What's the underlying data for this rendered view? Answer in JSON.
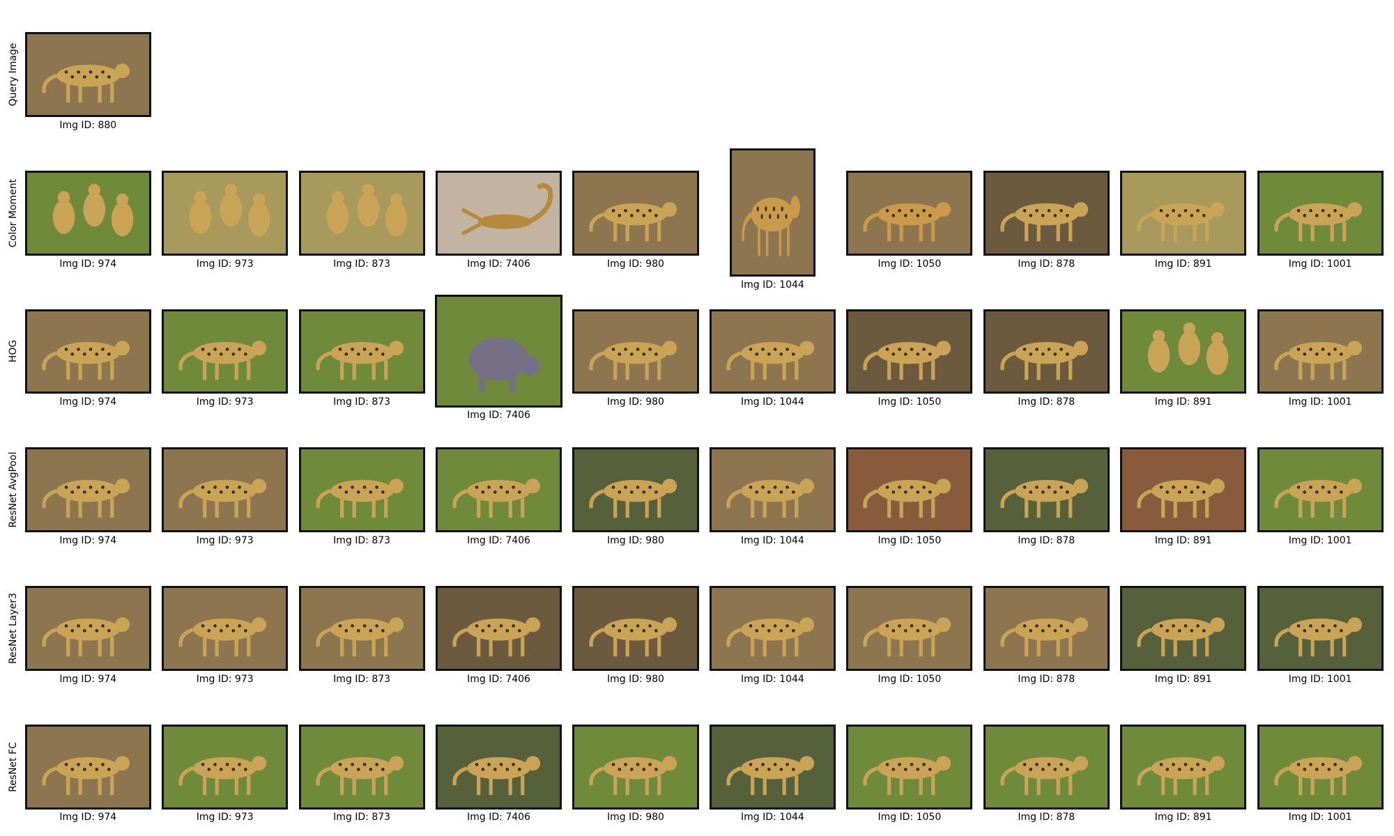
{
  "rows": [
    {
      "label": "Query Image",
      "tiles": [
        {
          "caption": "Img ID: 880",
          "subject": "cheetah",
          "scene": "dirt"
        }
      ]
    },
    {
      "label": "Color Moment",
      "tiles": [
        {
          "caption": "Img ID: 974",
          "subject": "cheetah group",
          "scene": "grass"
        },
        {
          "caption": "Img ID: 973",
          "subject": "cheetah group",
          "scene": "dry grass"
        },
        {
          "caption": "Img ID: 873",
          "subject": "cheetah group",
          "scene": "dry grass"
        },
        {
          "caption": "Img ID: 7406",
          "subject": "scorpion",
          "scene": "gravel"
        },
        {
          "caption": "Img ID: 980",
          "subject": "cheetah",
          "scene": "dirt"
        },
        {
          "caption": "Img ID: 1044",
          "subject": "leopard",
          "scene": "dirt"
        },
        {
          "caption": "Img ID: 1050",
          "subject": "leopard",
          "scene": "dirt"
        },
        {
          "caption": "Img ID: 878",
          "subject": "cheetah",
          "scene": "dark dirt"
        },
        {
          "caption": "Img ID: 891",
          "subject": "cheetah",
          "scene": "dry grass"
        },
        {
          "caption": "Img ID: 1001",
          "subject": "cheetah",
          "scene": "grass"
        }
      ]
    },
    {
      "label": "HOG",
      "tiles": [
        {
          "caption": "Img ID: 974",
          "subject": "cheetah",
          "scene": "dirt"
        },
        {
          "caption": "Img ID: 973",
          "subject": "cheetah",
          "scene": "grass"
        },
        {
          "caption": "Img ID: 873",
          "subject": "cheetah",
          "scene": "grass"
        },
        {
          "caption": "Img ID: 7406",
          "subject": "rhinoceros",
          "scene": "grass"
        },
        {
          "caption": "Img ID: 980",
          "subject": "cheetah",
          "scene": "dirt"
        },
        {
          "caption": "Img ID: 1044",
          "subject": "cheetah",
          "scene": "dirt"
        },
        {
          "caption": "Img ID: 1050",
          "subject": "cheetah",
          "scene": "dark dirt"
        },
        {
          "caption": "Img ID: 878",
          "subject": "cheetah",
          "scene": "dark dirt"
        },
        {
          "caption": "Img ID: 891",
          "subject": "cheetah group",
          "scene": "grass"
        },
        {
          "caption": "Img ID: 1001",
          "subject": "cheetah",
          "scene": "dirt"
        }
      ]
    },
    {
      "label": "ResNet AvgPool",
      "tiles": [
        {
          "caption": "Img ID: 974",
          "subject": "cheetah",
          "scene": "dirt"
        },
        {
          "caption": "Img ID: 973",
          "subject": "cheetah",
          "scene": "dirt"
        },
        {
          "caption": "Img ID: 873",
          "subject": "cheetah",
          "scene": "grass"
        },
        {
          "caption": "Img ID: 7406",
          "subject": "cheetah",
          "scene": "grass"
        },
        {
          "caption": "Img ID: 980",
          "subject": "cheetah",
          "scene": "dark grass"
        },
        {
          "caption": "Img ID: 1044",
          "subject": "cheetah",
          "scene": "dirt"
        },
        {
          "caption": "Img ID: 1050",
          "subject": "cheetah",
          "scene": "red grass"
        },
        {
          "caption": "Img ID: 878",
          "subject": "cheetah",
          "scene": "dark grass"
        },
        {
          "caption": "Img ID: 891",
          "subject": "cheetah",
          "scene": "red grass"
        },
        {
          "caption": "Img ID: 1001",
          "subject": "cheetah",
          "scene": "grass"
        }
      ]
    },
    {
      "label": "ResNet Layer3",
      "tiles": [
        {
          "caption": "Img ID: 974",
          "subject": "cheetah",
          "scene": "dirt"
        },
        {
          "caption": "Img ID: 973",
          "subject": "cheetah",
          "scene": "dirt"
        },
        {
          "caption": "Img ID: 873",
          "subject": "cheetah",
          "scene": "dirt"
        },
        {
          "caption": "Img ID: 7406",
          "subject": "cheetah",
          "scene": "dark dirt"
        },
        {
          "caption": "Img ID: 980",
          "subject": "cheetah",
          "scene": "dark dirt"
        },
        {
          "caption": "Img ID: 1044",
          "subject": "cheetah",
          "scene": "dirt"
        },
        {
          "caption": "Img ID: 1050",
          "subject": "cheetah",
          "scene": "dirt"
        },
        {
          "caption": "Img ID: 878",
          "subject": "cheetah",
          "scene": "dirt"
        },
        {
          "caption": "Img ID: 891",
          "subject": "cheetah",
          "scene": "dark grass"
        },
        {
          "caption": "Img ID: 1001",
          "subject": "cheetah",
          "scene": "dark grass"
        }
      ]
    },
    {
      "label": "ResNet FC",
      "tiles": [
        {
          "caption": "Img ID: 974",
          "subject": "cheetah",
          "scene": "dirt"
        },
        {
          "caption": "Img ID: 973",
          "subject": "cheetah",
          "scene": "grass"
        },
        {
          "caption": "Img ID: 873",
          "subject": "cheetah",
          "scene": "grass"
        },
        {
          "caption": "Img ID: 7406",
          "subject": "cheetah",
          "scene": "dark grass"
        },
        {
          "caption": "Img ID: 980",
          "subject": "cheetah",
          "scene": "grass"
        },
        {
          "caption": "Img ID: 1044",
          "subject": "cheetah",
          "scene": "dark grass"
        },
        {
          "caption": "Img ID: 1050",
          "subject": "cheetah",
          "scene": "grass"
        },
        {
          "caption": "Img ID: 878",
          "subject": "cheetah",
          "scene": "grass"
        },
        {
          "caption": "Img ID: 891",
          "subject": "cheetah",
          "scene": "grass"
        },
        {
          "caption": "Img ID: 1001",
          "subject": "cheetah",
          "scene": "grass"
        }
      ]
    }
  ],
  "scene_colors": {
    "dirt": "#8d7550",
    "dark dirt": "#6b5a3e",
    "grass": "#6f8a3a",
    "dry grass": "#a89a5c",
    "dark grass": "#56603a",
    "red grass": "#8a5a3c",
    "gravel": "#c2b4a0"
  },
  "subject_colors": {
    "cheetah": "#c9a356",
    "cheetah group": "#c9a356",
    "leopard": "#c99a4c",
    "scorpion": "#b58a3c",
    "rhinoceros": "#767086"
  }
}
